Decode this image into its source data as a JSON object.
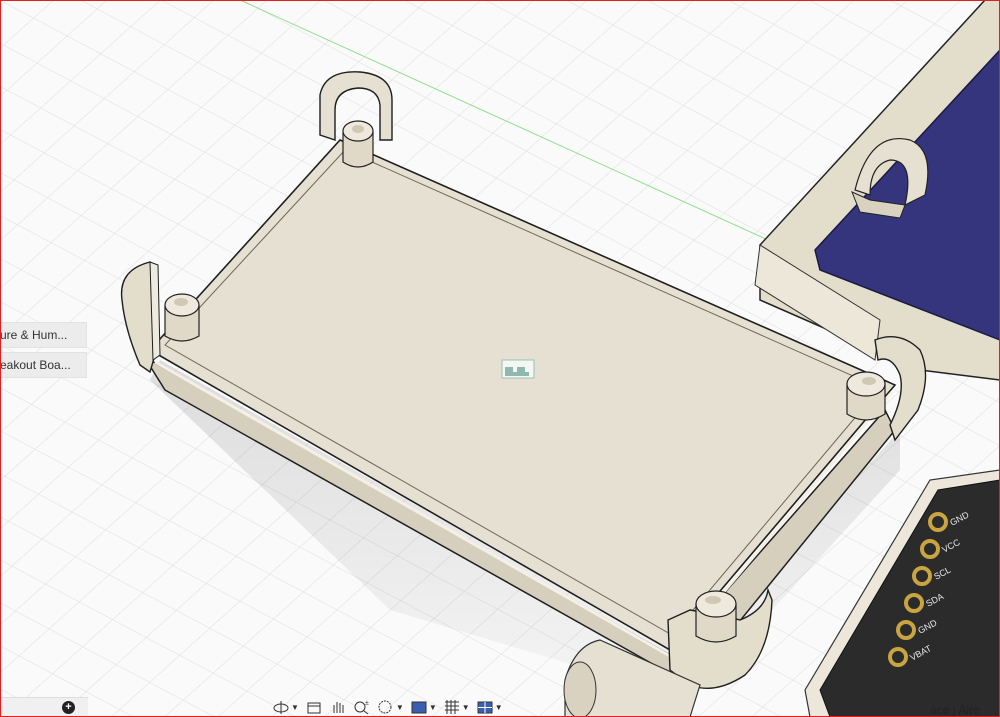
{
  "browser": {
    "items": [
      {
        "label": "ure & Hum..."
      },
      {
        "label": "eakout Boa..."
      }
    ]
  },
  "toolbar": {
    "buttons": [
      {
        "icon": "orbit-icon",
        "has_menu": true
      },
      {
        "icon": "look-at-icon",
        "has_menu": false
      },
      {
        "icon": "pan-hand-icon",
        "has_menu": false
      },
      {
        "icon": "zoom-icon",
        "has_menu": false
      },
      {
        "icon": "fit-window-icon",
        "has_menu": true
      },
      {
        "icon": "display-settings-icon",
        "has_menu": true
      },
      {
        "icon": "grid-snap-icon",
        "has_menu": true
      },
      {
        "icon": "viewports-icon",
        "has_menu": true
      }
    ]
  },
  "status": {
    "right_text": "ace | Aire"
  },
  "board": {
    "pins": [
      "GND",
      "VCC",
      "SCL",
      "SDA",
      "GND",
      "VBAT"
    ]
  },
  "colors": {
    "model": "#e6e0d2",
    "model_edge": "#1f1f1f",
    "pcb": "#2b2b2b",
    "display": "#33337a",
    "grid": "#d8d8d8",
    "axis_green": "#7fdd7f"
  }
}
